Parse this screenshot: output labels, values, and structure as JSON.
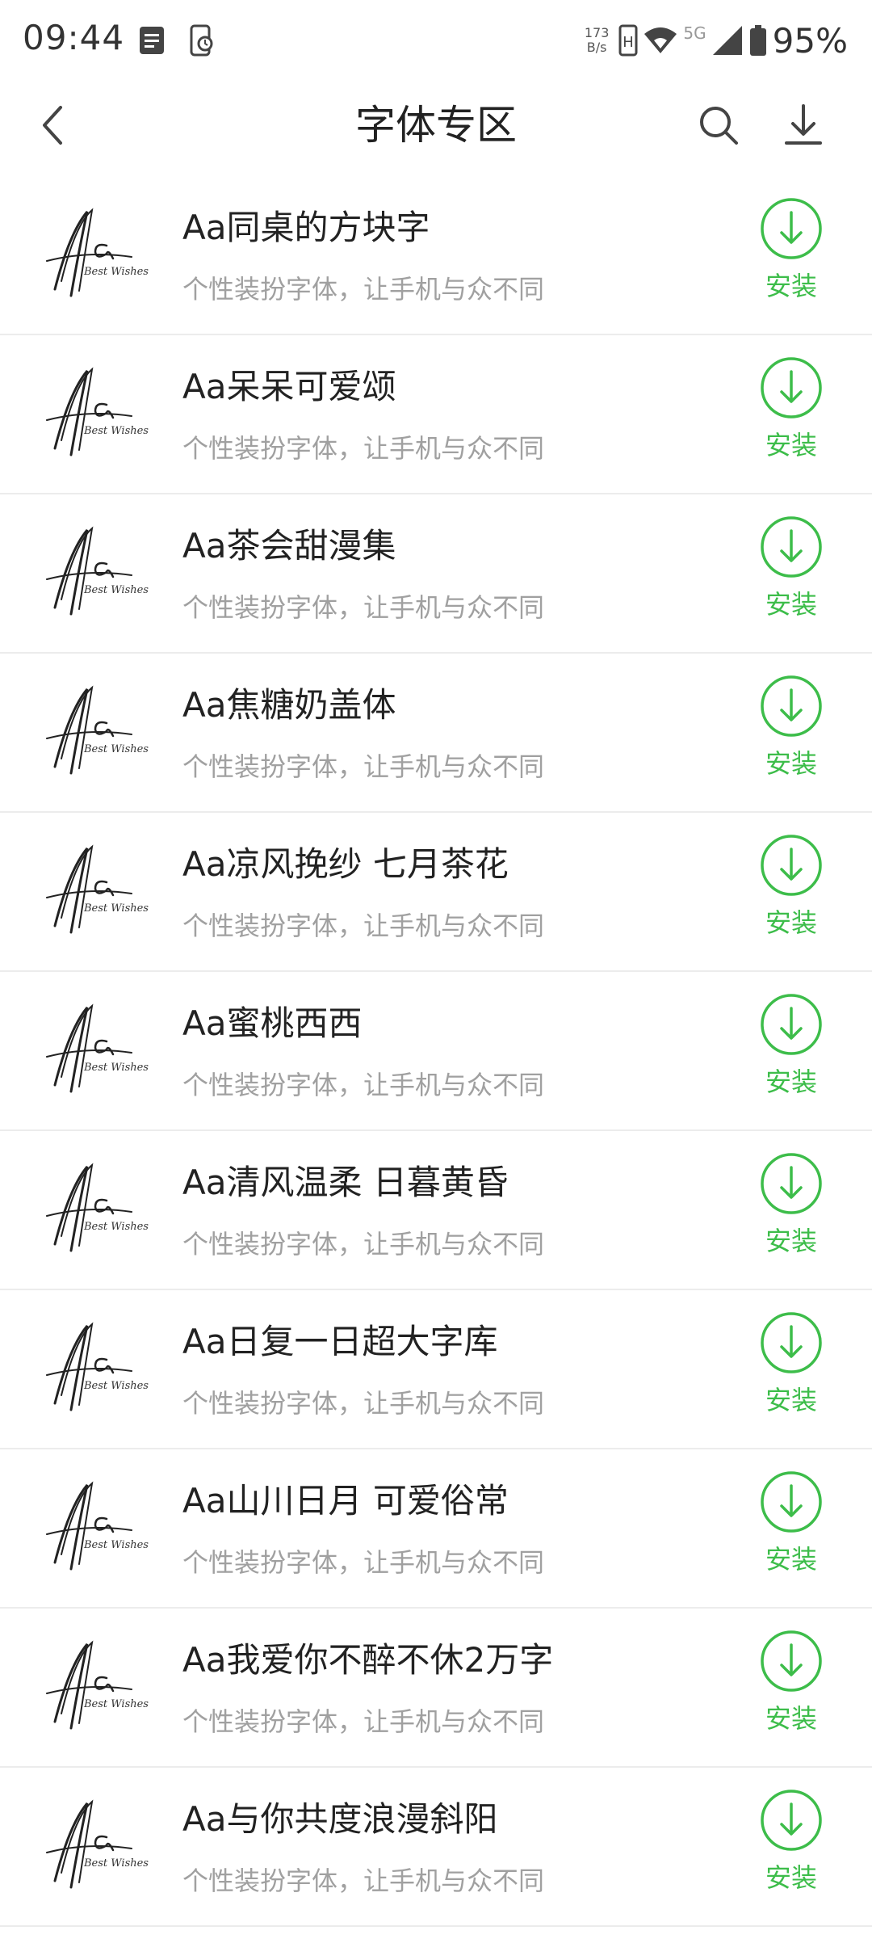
{
  "status_bar": {
    "time": "09:44",
    "net_speed_value": "173",
    "net_speed_unit": "B/s",
    "network_label": "5G",
    "battery": "95%",
    "icons": [
      "notes-icon",
      "phone-sync-icon",
      "hd-icon",
      "wifi-icon",
      "signal-icon",
      "battery-icon"
    ]
  },
  "header": {
    "title": "字体专区",
    "icons": [
      "back-icon",
      "search-icon",
      "download-icon"
    ]
  },
  "colors": {
    "accent": "#3dbd4a",
    "secondary_text": "#a0a0a0",
    "divider": "#ececec"
  },
  "thumbnail_text": {
    "main": "Aa",
    "sub": "Best Wishes"
  },
  "fonts": [
    {
      "name": "Aa同桌的方块字",
      "desc": "个性装扮字体，让手机与众不同",
      "action": "安装"
    },
    {
      "name": "Aa呆呆可爱颂",
      "desc": "个性装扮字体，让手机与众不同",
      "action": "安装"
    },
    {
      "name": "Aa茶会甜漫集",
      "desc": "个性装扮字体，让手机与众不同",
      "action": "安装"
    },
    {
      "name": "Aa焦糖奶盖体",
      "desc": "个性装扮字体，让手机与众不同",
      "action": "安装"
    },
    {
      "name": "Aa凉风挽纱 七月茶花",
      "desc": "个性装扮字体，让手机与众不同",
      "action": "安装"
    },
    {
      "name": "Aa蜜桃西西",
      "desc": "个性装扮字体，让手机与众不同",
      "action": "安装"
    },
    {
      "name": "Aa清风温柔 日暮黄昏",
      "desc": "个性装扮字体，让手机与众不同",
      "action": "安装"
    },
    {
      "name": "Aa日复一日超大字库",
      "desc": "个性装扮字体，让手机与众不同",
      "action": "安装"
    },
    {
      "name": "Aa山川日月 可爱俗常",
      "desc": "个性装扮字体，让手机与众不同",
      "action": "安装"
    },
    {
      "name": "Aa我爱你不醉不休2万字",
      "desc": "个性装扮字体，让手机与众不同",
      "action": "安装"
    },
    {
      "name": "Aa与你共度浪漫斜阳",
      "desc": "个性装扮字体，让手机与众不同",
      "action": "安装"
    }
  ]
}
